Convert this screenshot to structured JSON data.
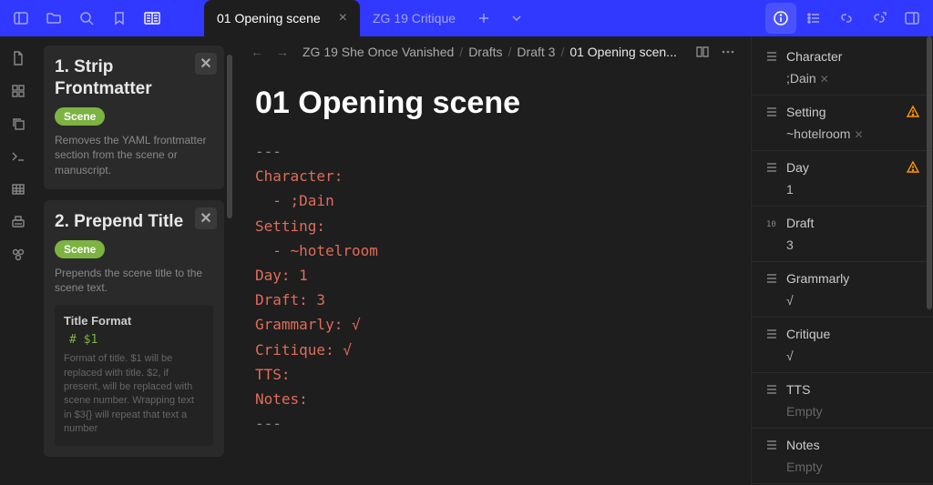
{
  "tabs": [
    {
      "label": "01 Opening scene",
      "active": true
    },
    {
      "label": "ZG 19 Critique",
      "active": false
    }
  ],
  "breadcrumb": {
    "parts": [
      "ZG 19 She Once Vanished",
      "Drafts",
      "Draft 3"
    ],
    "current": "01 Opening scen..."
  },
  "sidebar": {
    "cards": [
      {
        "title": "1. Strip Frontmatter",
        "badge": "Scene",
        "desc": "Removes the YAML frontmatter section from the scene or manuscript."
      },
      {
        "title": "2. Prepend Title",
        "badge": "Scene",
        "desc": "Prepends the scene title to the scene text.",
        "sub": {
          "heading": "Title Format",
          "format": "# $1",
          "help": "Format of title. $1 will be replaced with title. $2, if present, will be replaced with scene number. Wrapping text in $3{} will repeat that text a number"
        }
      }
    ]
  },
  "document": {
    "title": "01 Opening scene",
    "front": {
      "sep": "---",
      "lines": [
        {
          "key": "Character:",
          "items": [
            "  - ;Dain"
          ]
        },
        {
          "key": "Setting:",
          "items": [
            "  - ~hotelroom"
          ]
        },
        {
          "key": "Day:",
          "inline": " 1"
        },
        {
          "key": "Draft:",
          "inline": " 3"
        },
        {
          "key": "Grammarly:",
          "inline": " √"
        },
        {
          "key": "Critique:",
          "inline": " √"
        },
        {
          "key": "TTS:",
          "inline": ""
        },
        {
          "key": "Notes:",
          "inline": ""
        }
      ]
    }
  },
  "props": [
    {
      "icon": "list",
      "label": "Character",
      "value": ";Dain",
      "removable": true
    },
    {
      "icon": "list",
      "label": "Setting",
      "value": "~hotelroom",
      "removable": true,
      "warn": true
    },
    {
      "icon": "list",
      "label": "Day",
      "value": "1",
      "warn": true
    },
    {
      "icon": "num",
      "label": "Draft",
      "value": "3"
    },
    {
      "icon": "list",
      "label": "Grammarly",
      "value": "√"
    },
    {
      "icon": "list",
      "label": "Critique",
      "value": "√"
    },
    {
      "icon": "list",
      "label": "TTS",
      "value": "Empty",
      "empty": true
    },
    {
      "icon": "list",
      "label": "Notes",
      "value": "Empty",
      "empty": true
    }
  ]
}
